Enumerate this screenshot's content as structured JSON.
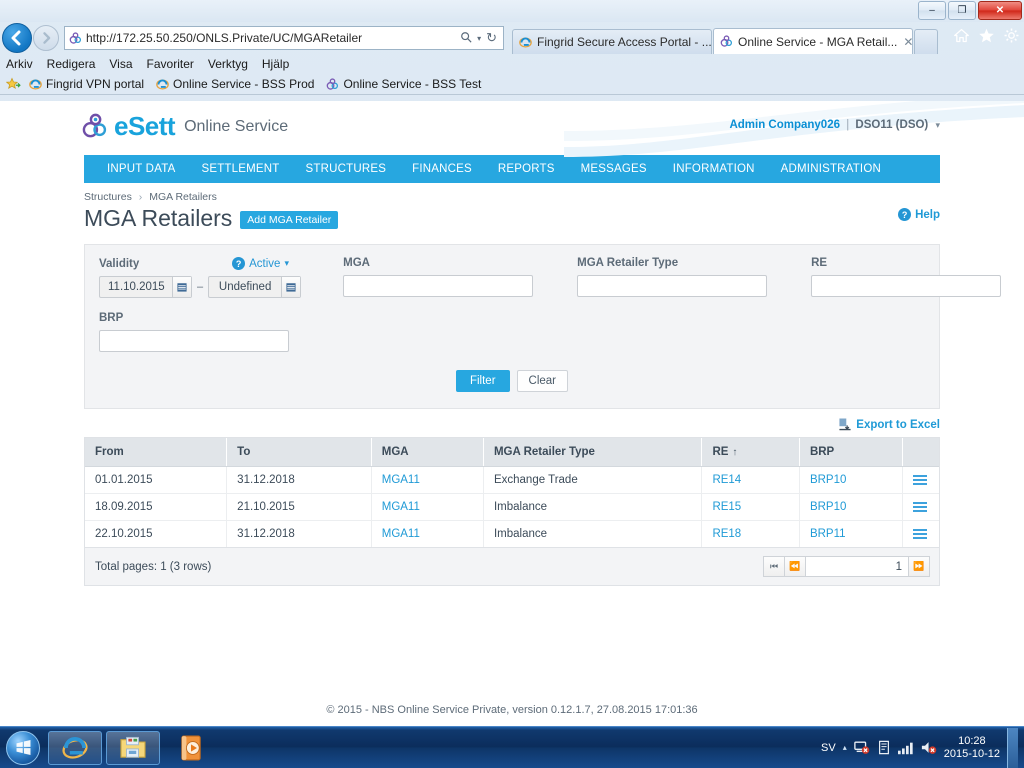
{
  "browser": {
    "window_buttons": {
      "minimize": "–",
      "restore": "❐",
      "close": "✕"
    },
    "back_label": "←",
    "forward_label": "→",
    "address": "http://172.25.50.250/ONLS.Private/UC/MGARetailer",
    "address_search_icon": "search-icon",
    "address_refresh_icon": "↻",
    "tabs": [
      {
        "title": "Fingrid Secure Access Portal - ...",
        "active": false,
        "icon": "ie-icon"
      },
      {
        "title": "Online Service - MGA Retail...",
        "active": true,
        "icon": "esett-icon",
        "close": "✕"
      }
    ],
    "menu": [
      "Arkiv",
      "Redigera",
      "Visa",
      "Favoriter",
      "Verktyg",
      "Hjälp"
    ],
    "favorites": [
      {
        "label": "Fingrid VPN portal",
        "icon": "ie-icon"
      },
      {
        "label": "Online Service - BSS Prod",
        "icon": "ie-icon"
      },
      {
        "label": "Online Service - BSS Test",
        "icon": "esett-icon"
      }
    ],
    "toolbar_icons": [
      "home-icon",
      "star-icon",
      "gear-icon"
    ]
  },
  "app": {
    "logo_text": "eSett",
    "logo_subtitle": "Online Service",
    "user": {
      "name": "Admin Company026",
      "separator": "|",
      "org": "DSO11 (DSO)",
      "caret": "▾"
    },
    "nav": [
      "INPUT DATA",
      "SETTLEMENT",
      "STRUCTURES",
      "FINANCES",
      "REPORTS",
      "MESSAGES",
      "INFORMATION",
      "ADMINISTRATION"
    ],
    "breadcrumb": {
      "parent": "Structures",
      "arrow": "›",
      "current": "MGA Retailers"
    },
    "page_title": "MGA Retailers",
    "add_button": "Add MGA Retailer",
    "help_link": "Help",
    "help_icon_char": "?"
  },
  "filter": {
    "validity": {
      "label": "Validity",
      "status_icon_char": "?",
      "status_label": "Active",
      "status_caret": "▾",
      "from_value": "11.10.2015",
      "to_value": "Undefined",
      "dash": "–",
      "calendar_icon": "calendar-icon"
    },
    "fields": [
      {
        "label": "MGA",
        "value": "",
        "placeholder": "",
        "width": 190
      },
      {
        "label": "MGA Retailer Type",
        "value": "",
        "placeholder": "",
        "width": 190
      },
      {
        "label": "RE",
        "value": "",
        "placeholder": "",
        "width": 190
      },
      {
        "label": "BRP",
        "value": "",
        "placeholder": "",
        "width": 190
      }
    ],
    "filter_button": "Filter",
    "clear_button": "Clear"
  },
  "export": {
    "label": "Export to Excel",
    "icon": "excel-export-icon"
  },
  "table": {
    "columns": [
      {
        "label": "From",
        "sorted": false
      },
      {
        "label": "To",
        "sorted": false
      },
      {
        "label": "MGA",
        "sorted": false
      },
      {
        "label": "MGA Retailer Type",
        "sorted": false
      },
      {
        "label": "RE",
        "sorted": true,
        "sort_arrow": "↑"
      },
      {
        "label": "BRP",
        "sorted": false
      },
      {
        "label": "",
        "sorted": false
      }
    ],
    "rows": [
      {
        "from": "01.01.2015",
        "to": "31.12.2018",
        "mga": "MGA11",
        "type": "Exchange Trade",
        "re": "RE14",
        "brp": "BRP10"
      },
      {
        "from": "18.09.2015",
        "to": "21.10.2015",
        "mga": "MGA11",
        "type": "Imbalance",
        "re": "RE15",
        "brp": "BRP10"
      },
      {
        "from": "22.10.2015",
        "to": "31.12.2018",
        "mga": "MGA11",
        "type": "Imbalance",
        "re": "RE18",
        "brp": "BRP11"
      }
    ],
    "footer_text": "Total pages: 1 (3 rows)",
    "pager": {
      "first": "⏮",
      "prev": "⏪",
      "page_value": "1",
      "last": "⏩"
    }
  },
  "footer": {
    "copyright": "© 2015 - NBS Online Service Private, version 0.12.1.7, 27.08.2015 17:01:36"
  },
  "taskbar": {
    "start_icon": "windows-start-icon",
    "items": [
      "ie-icon",
      "explorer-icon",
      "media-icon"
    ],
    "tray": {
      "language": "SV",
      "expand": "▴",
      "icons": [
        "network-error-icon",
        "action-center-icon",
        "signal-icon",
        "volume-mute-icon"
      ]
    },
    "clock_time": "10:28",
    "clock_date": "2015-10-12"
  },
  "colors": {
    "accent": "#27a7e0",
    "link": "#1f9ad6",
    "nav_bg": "#27a7e0",
    "panel_bg": "#f3f4f6",
    "header_row": "#e1e5e9"
  }
}
